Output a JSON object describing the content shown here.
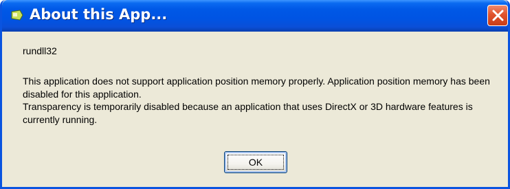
{
  "window": {
    "title": "About this App...",
    "close_icon": "close-icon",
    "app_icon": "app-icon"
  },
  "body": {
    "app_name": "rundll32",
    "paragraph_1": "This application does not support application position memory properly. Application position memory has been disabled for this application.",
    "paragraph_2": "Transparency is temporarily disabled because an application that uses DirectX or 3D hardware features is currently running."
  },
  "buttons": {
    "ok_label": "OK"
  },
  "colors": {
    "titlebar": "#0054e3",
    "close_button": "#e0532d",
    "dialog_background": "#ece9d8"
  }
}
